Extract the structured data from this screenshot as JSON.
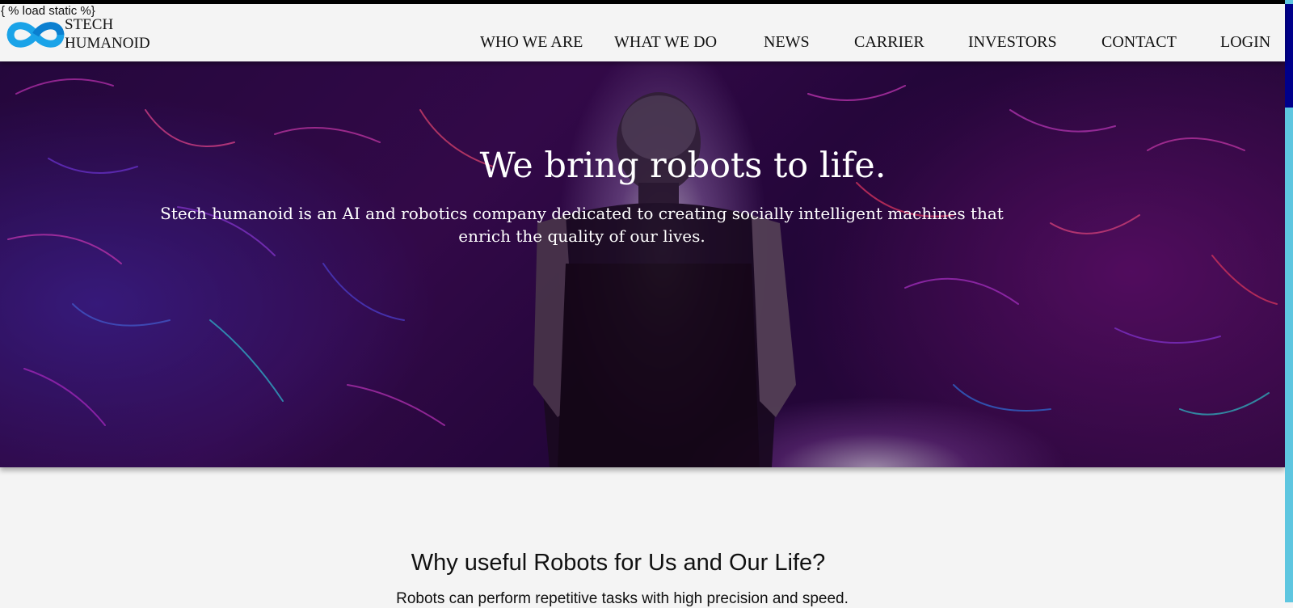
{
  "page": {
    "template_tag": "{ % load static %}"
  },
  "header": {
    "logo_icon": "infinity-logo-icon",
    "brand_line1": "STECH",
    "brand_line2": "HUMANOID",
    "nav": [
      {
        "label": "WHO WE ARE"
      },
      {
        "label": "WHAT WE DO"
      },
      {
        "label": "NEWS"
      },
      {
        "label": "CARRIER"
      },
      {
        "label": "INVESTORS"
      },
      {
        "label": "CONTACT"
      },
      {
        "label": "LOGIN"
      }
    ]
  },
  "hero": {
    "title": "We bring robots to life.",
    "subtitle": "Stech humanoid is an AI and robotics company dedicated to creating socially intelligent machines that enrich the quality of our lives."
  },
  "section": {
    "title": "Why useful Robots for Us and Our Life?",
    "text": "Robots can perform repetitive tasks with high precision and speed."
  },
  "colors": {
    "logo_blue": "#1aa3e8",
    "scrollbar_track": "#5ec6e0",
    "scrollbar_thumb": "#00008b",
    "page_bg": "#f4f4f4"
  }
}
